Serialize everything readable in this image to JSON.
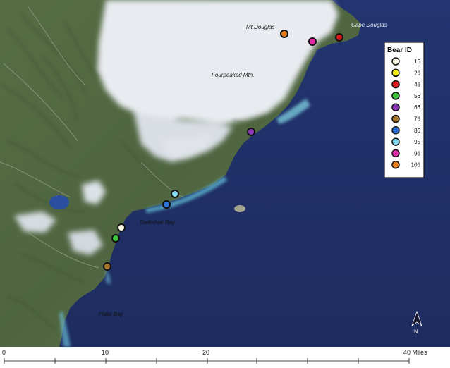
{
  "places": {
    "mt_douglas": "Mt.Douglas",
    "cape_douglas": "Cape Douglas",
    "fourpeaked": "Fourpeaked Mtn.",
    "swikshak": "Swikshak Bay",
    "hallo": "Hallo Bay"
  },
  "legend": {
    "title": "Bear ID",
    "items": [
      {
        "id": "16",
        "color": "#fffbe8"
      },
      {
        "id": "26",
        "color": "#f5ee1e"
      },
      {
        "id": "46",
        "color": "#d8191c"
      },
      {
        "id": "56",
        "color": "#3cc23a"
      },
      {
        "id": "66",
        "color": "#8a37b8"
      },
      {
        "id": "76",
        "color": "#a7772e"
      },
      {
        "id": "86",
        "color": "#2a6fd6"
      },
      {
        "id": "95",
        "color": "#82d8ee"
      },
      {
        "id": "96",
        "color": "#e12aa7"
      },
      {
        "id": "106",
        "color": "#e87d1e"
      }
    ]
  },
  "bears": [
    {
      "id": "106",
      "lon": 0,
      "lat": 0
    },
    {
      "id": "96"
    },
    {
      "id": "46"
    },
    {
      "id": "66"
    },
    {
      "id": "95"
    },
    {
      "id": "86"
    },
    {
      "id": "16"
    },
    {
      "id": "56"
    },
    {
      "id": "76"
    }
  ],
  "north_label": "N",
  "scale": {
    "labels": [
      "0",
      "10",
      "20",
      "40 Miles"
    ]
  }
}
